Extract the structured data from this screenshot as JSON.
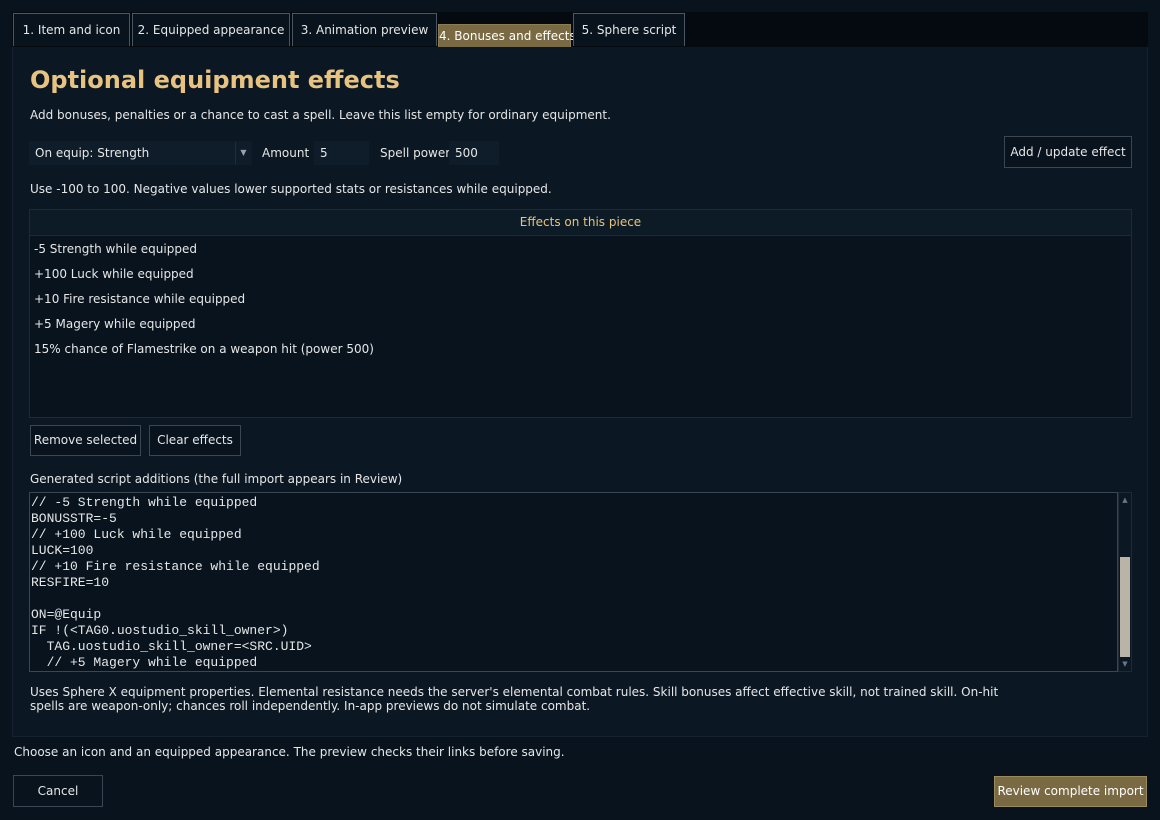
{
  "tabs": [
    {
      "label": "1. Item and icon"
    },
    {
      "label": "2. Equipped appearance"
    },
    {
      "label": "3. Animation preview"
    },
    {
      "label": "4. Bonuses and effects"
    },
    {
      "label": "5. Sphere script"
    }
  ],
  "active_tab": "4. Bonuses and effects",
  "section": {
    "title": "Optional equipment effects",
    "description": "Add bonuses, penalties or a chance to cast a spell. Leave this list empty for ordinary equipment."
  },
  "form": {
    "effect_select_value": "On equip: Strength",
    "amount_label": "Amount",
    "amount_value": "5",
    "spell_power_label": "Spell power",
    "spell_power_value": "500",
    "add_button": "Add / update effect",
    "hint": "Use -100 to 100. Negative values lower supported stats or resistances while equipped."
  },
  "effects_list": {
    "header": "Effects on this piece",
    "items": [
      "-5 Strength while equipped",
      "+100 Luck while equipped",
      "+10 Fire resistance while equipped",
      "+5 Magery while equipped",
      "15% chance of Flamestrike on a weapon hit (power 500)"
    ]
  },
  "list_buttons": {
    "remove": "Remove selected",
    "clear": "Clear effects"
  },
  "script": {
    "label": "Generated script additions (the full import appears in Review)",
    "code": "// -5 Strength while equipped\nBONUSSTR=-5\n// +100 Luck while equipped\nLUCK=100\n// +10 Fire resistance while equipped\nRESFIRE=10\n\nON=@Equip\nIF !(<TAG0.uostudio_skill_owner>)\n  TAG.uostudio_skill_owner=<SRC.UID>\n  // +5 Magery while equipped"
  },
  "notes": {
    "line1": "Uses Sphere X equipment properties. Elemental resistance needs the server's elemental combat rules. Skill bonuses affect effective skill, not trained skill. On-hit",
    "line2": "spells are weapon-only; chances roll independently. In-app previews do not simulate combat."
  },
  "footer": {
    "status": "Choose an icon and an equipped appearance. The preview checks their links before saving.",
    "cancel": "Cancel",
    "review": "Review complete import"
  },
  "colors": {
    "accent": "#e8c27f",
    "active_tab": "#7a6a43",
    "background": "#08131e"
  }
}
